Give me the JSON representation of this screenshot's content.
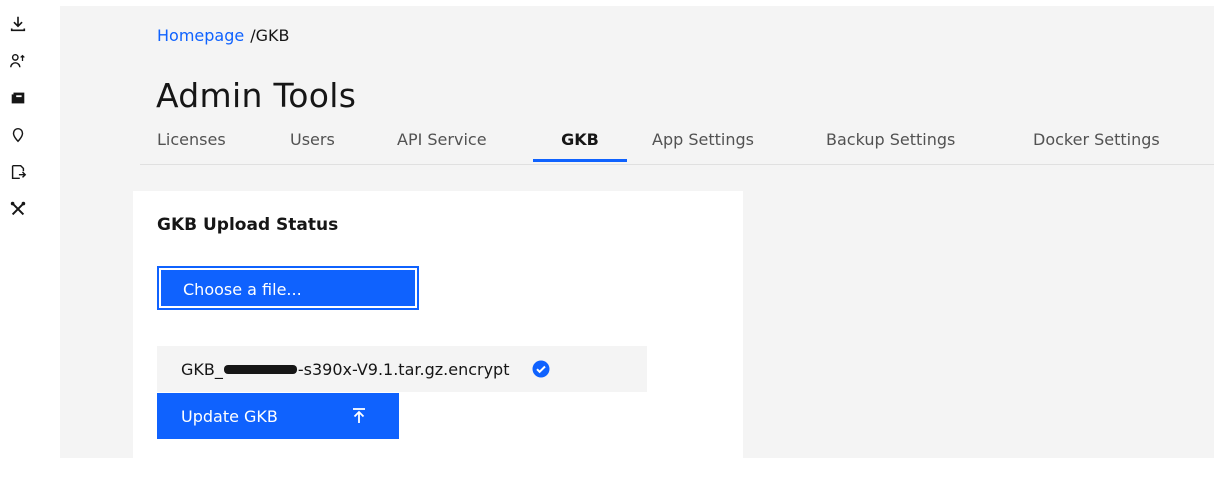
{
  "breadcrumb": {
    "home": "Homepage",
    "current": "/GKB"
  },
  "page": {
    "title": "Admin Tools"
  },
  "tabs": [
    {
      "label": "Licenses",
      "active": false
    },
    {
      "label": "Users",
      "active": false
    },
    {
      "label": "API Service",
      "active": false
    },
    {
      "label": "GKB",
      "active": true
    },
    {
      "label": "App Settings",
      "active": false
    },
    {
      "label": "Backup Settings",
      "active": false
    },
    {
      "label": "Docker Settings",
      "active": false
    }
  ],
  "rail": {
    "icons": [
      "download-icon",
      "user-admin-icon",
      "catalog-icon",
      "location-icon",
      "document-export-icon",
      "tools-icon"
    ]
  },
  "card": {
    "title": "GKB Upload Status",
    "choose_label": "Choose a file...",
    "file": {
      "prefix": "GKB_",
      "suffix": "-s390x-V9.1.tar.gz.encrypt",
      "status": "uploaded"
    },
    "update_label": "Update GKB"
  },
  "colors": {
    "accent": "#0f62fe",
    "background": "#f4f4f4",
    "text": "#161616"
  }
}
